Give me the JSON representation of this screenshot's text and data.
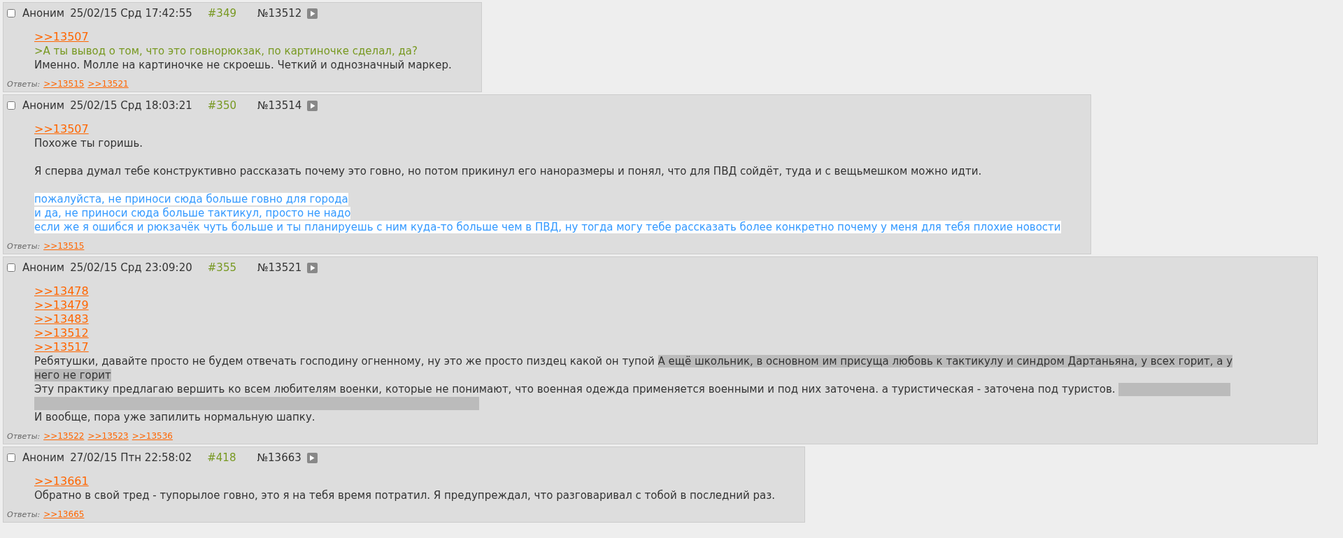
{
  "posts": [
    {
      "checked": false,
      "author": "Аноним",
      "date": "25/02/15 Срд 17:42:55",
      "number": "#349",
      "post_id": "№13512",
      "body": [
        {
          "kind": "reply_link",
          "text": ">>13507"
        },
        {
          "kind": "quote",
          "text": ">А ты вывод о том, что это говнорюкзак, по картиночке сделал, да?"
        },
        {
          "kind": "text",
          "text": "Именно. Молле на картиночке не скроешь. Четкий и однозначный маркер."
        }
      ],
      "replies_label": "Ответы:",
      "replies": [
        ">>13515",
        ">>13521"
      ]
    },
    {
      "checked": false,
      "author": "Аноним",
      "date": "25/02/15 Срд 18:03:21",
      "number": "#350",
      "post_id": "№13514",
      "body": [
        {
          "kind": "reply_link",
          "text": ">>13507"
        },
        {
          "kind": "text",
          "text": "Похоже ты горишь."
        },
        {
          "kind": "blank"
        },
        {
          "kind": "text",
          "text": "Я сперва думал тебе конструктивно рассказать почему это говно, но потом прикинул его наноразмеры и понял, что для ПВД сойдёт, туда и с вещьмешком можно идти."
        },
        {
          "kind": "blank"
        },
        {
          "kind": "highlight",
          "text": "пожалуйста, не приноси сюда больше говно для города"
        },
        {
          "kind": "highlight",
          "text": "и да, не приноси сюда больше тактикул, просто не надо"
        },
        {
          "kind": "highlight",
          "text": "если же я ошибся и рюкзачёк чуть больше и ты планируешь с ним куда-то больше чем в ПВД, ну тогда могу тебе рассказать более конкретно почему у меня для тебя плохие новости"
        }
      ],
      "replies_label": "Ответы:",
      "replies": [
        ">>13515"
      ]
    },
    {
      "checked": false,
      "author": "Аноним",
      "date": "25/02/15 Срд 23:09:20",
      "number": "#355",
      "post_id": "№13521",
      "body": [
        {
          "kind": "reply_link",
          "text": ">>13478"
        },
        {
          "kind": "reply_link",
          "text": ">>13479"
        },
        {
          "kind": "reply_link",
          "text": ">>13483"
        },
        {
          "kind": "reply_link",
          "text": ">>13512"
        },
        {
          "kind": "reply_link",
          "text": ">>13517"
        },
        {
          "kind": "mixed",
          "segments": [
            {
              "kind": "text",
              "text": "Ребятушки, давайте просто не будем отвечать господину огненному, ну это же просто пиздец какой он тупой"
            },
            {
              "kind": "spoiler",
              "text": "А ещё школьник, в основном им присуща любовь к тактикулу и синдром Дартаньяна, у всех горит, а у"
            }
          ]
        },
        {
          "kind": "mixed",
          "segments": [
            {
              "kind": "spoiler",
              "text": "него не горит"
            }
          ]
        },
        {
          "kind": "mixed",
          "segments": [
            {
              "kind": "text",
              "text": "Эту практику предлагаю вершить ко всем любителям военки, которые не понимают, что военная одежда применяется военными и под них заточена. а туристическая - заточена под туристов."
            },
            {
              "kind": "hidden_spoiler"
            }
          ]
        },
        {
          "kind": "text",
          "text": "И вообще, пора уже запилить нормальную шапку."
        }
      ],
      "replies_label": "Ответы:",
      "replies": [
        ">>13522",
        ">>13523",
        ">>13536"
      ]
    },
    {
      "checked": false,
      "author": "Аноним",
      "date": "27/02/15 Птн 22:58:02",
      "number": "#418",
      "post_id": "№13663",
      "body": [
        {
          "kind": "reply_link",
          "text": ">>13661"
        },
        {
          "kind": "text",
          "text": "Обратно в свой тред - тупорылое говно, это я на тебя время потратил. Я предупреждал, что разговаривал с тобой в последний раз."
        }
      ],
      "replies_label": "Ответы:",
      "replies": [
        ">>13665"
      ]
    }
  ]
}
